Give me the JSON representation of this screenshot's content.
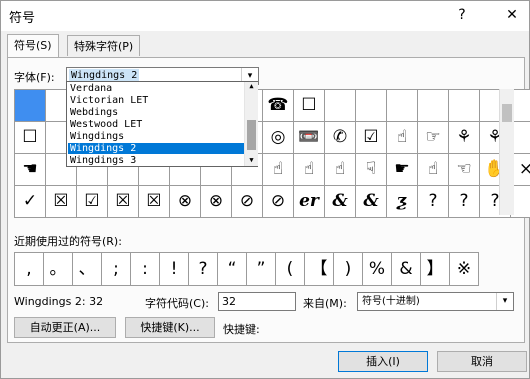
{
  "window": {
    "title": "符号",
    "help_btn": "?",
    "close_btn": "✕"
  },
  "tabs": [
    "符号(S)",
    "特殊字符(P)"
  ],
  "font": {
    "label": "字体(F):",
    "value": "Wingdings 2"
  },
  "dropdown": {
    "items": [
      "Verdana",
      "Victorian LET",
      "Webdings",
      "Westwood LET",
      "Wingdings",
      "Wingdings 2",
      "Wingdings 3"
    ],
    "highlighted_index": 5
  },
  "grid": {
    "rows": [
      [
        "",
        "",
        "",
        "",
        "",
        "",
        "",
        "",
        "☎",
        "☐",
        "",
        "",
        "",
        "",
        "",
        "",
        ""
      ],
      [
        "☐",
        "",
        "",
        "",
        "",
        "",
        "",
        "",
        "◎",
        "📼",
        "✆",
        "☑",
        "☝",
        "☞",
        "⚘",
        "⚘",
        ""
      ],
      [
        "☚",
        "",
        "",
        "",
        "",
        "",
        "",
        "",
        "☝",
        "☝",
        "☝",
        "☟",
        "☛",
        "☝",
        "☜",
        "✋",
        "×"
      ],
      [
        "✓",
        "☒",
        "☑",
        "☒",
        "☒",
        "⊗",
        "⊗",
        "⊘",
        "⊘",
        "er",
        "&",
        "&",
        "ƺ",
        "?",
        "?",
        "?",
        ""
      ]
    ]
  },
  "recent": {
    "label": "近期使用过的符号(R):",
    "symbols": [
      ",",
      "。",
      "、",
      ";",
      ":",
      "!",
      "?",
      "“",
      "”",
      "(",
      "【",
      ")",
      "%",
      "&",
      "】",
      "※"
    ]
  },
  "info": {
    "char_name": "Wingdings 2: 32",
    "code_label": "字符代码(C):",
    "code_value": "32",
    "from_label": "来自(M):",
    "from_value": "符号(十进制)"
  },
  "buttons": {
    "autocorrect": "自动更正(A)...",
    "shortcut_key": "快捷键(K)...",
    "shortcut_label": "快捷键:",
    "insert": "插入(I)",
    "cancel": "取消"
  }
}
